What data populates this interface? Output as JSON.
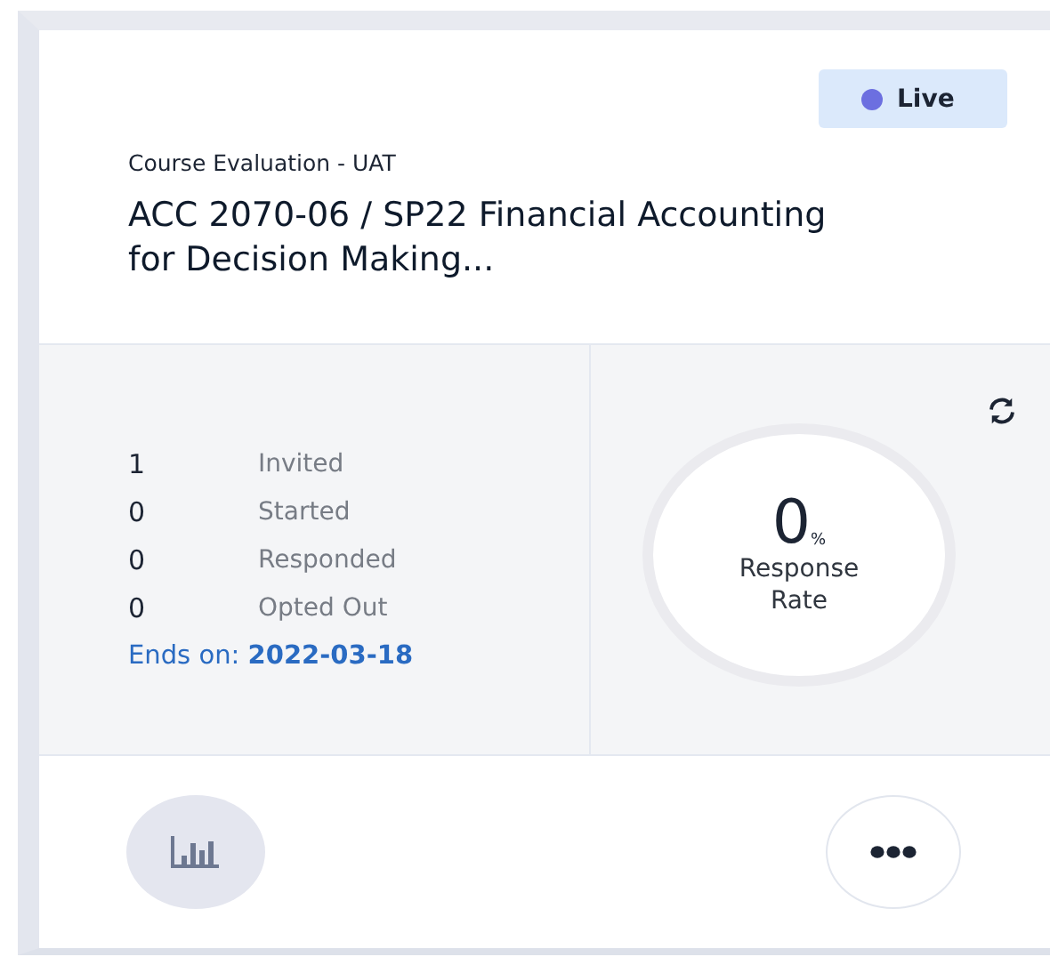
{
  "status": {
    "label": "Live",
    "color": "#6c6fe0"
  },
  "survey_type": "Course Evaluation - UAT",
  "title": "ACC 2070-06 / SP22 Financial Accounting for Decision Making...",
  "stats": [
    {
      "count": "1",
      "label": "Invited"
    },
    {
      "count": "0",
      "label": "Started"
    },
    {
      "count": "0",
      "label": "Responded"
    },
    {
      "count": "0",
      "label": "Opted Out"
    }
  ],
  "ends_on": "Ends on: **2022-03-18**",
  "response_rate": {
    "value": "0",
    "unit": "%",
    "label": "Response Rate"
  }
}
